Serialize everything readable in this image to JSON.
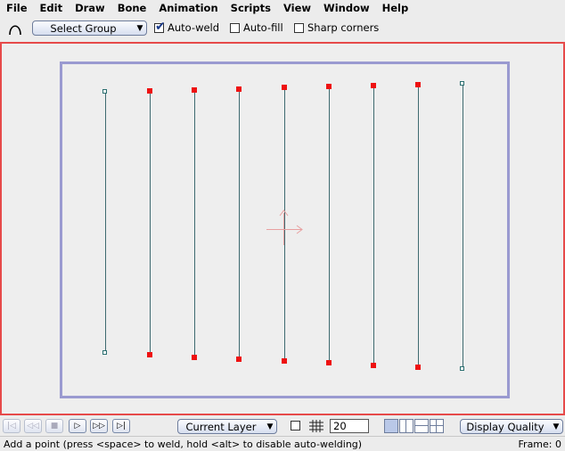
{
  "menu": [
    "File",
    "Edit",
    "Draw",
    "Bone",
    "Animation",
    "Scripts",
    "View",
    "Window",
    "Help"
  ],
  "toolbar": {
    "tool_icon": "add-point-curve-icon",
    "select_group": "Select Group",
    "auto_weld": {
      "label": "Auto-weld",
      "checked": true
    },
    "auto_fill": {
      "label": "Auto-fill",
      "checked": false
    },
    "sharp_corners": {
      "label": "Sharp corners",
      "checked": false
    }
  },
  "playback": {
    "buttons": [
      "rewind-to-start",
      "step-back",
      "stop",
      "play",
      "step-forward",
      "go-to-end"
    ],
    "layer_select": "Current Layer",
    "grid_enabled": false,
    "grid_size": "20",
    "display_quality": "Display Quality"
  },
  "status": {
    "message": "Add a point (press <space> to weld, hold <alt> to disable auto-welding)",
    "frame": "Frame: 0"
  },
  "colors": {
    "canvas_border": "#e64a4a",
    "frame_rect": "#9a9ad0",
    "point_selected": "#ee1111",
    "line": "#3e6a70"
  }
}
